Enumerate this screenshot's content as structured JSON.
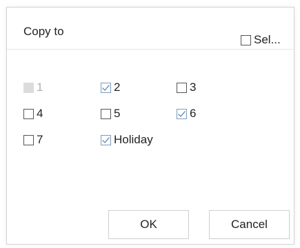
{
  "dialog": {
    "title": "Copy to",
    "select_all_label": "Sel...",
    "select_all_checked": false
  },
  "items": [
    {
      "label": "1",
      "checked": false,
      "disabled": true
    },
    {
      "label": "2",
      "checked": true,
      "disabled": false
    },
    {
      "label": "3",
      "checked": false,
      "disabled": false
    },
    {
      "label": "4",
      "checked": false,
      "disabled": false
    },
    {
      "label": "5",
      "checked": false,
      "disabled": false
    },
    {
      "label": "6",
      "checked": true,
      "disabled": false
    },
    {
      "label": "7",
      "checked": false,
      "disabled": false
    },
    {
      "label": "Holiday",
      "checked": true,
      "disabled": false
    }
  ],
  "buttons": {
    "ok_label": "OK",
    "cancel_label": "Cancel"
  },
  "colors": {
    "check_mark": "#6f8fb3",
    "disabled_box": "#dcdcdc",
    "border": "#d4d4d4"
  }
}
